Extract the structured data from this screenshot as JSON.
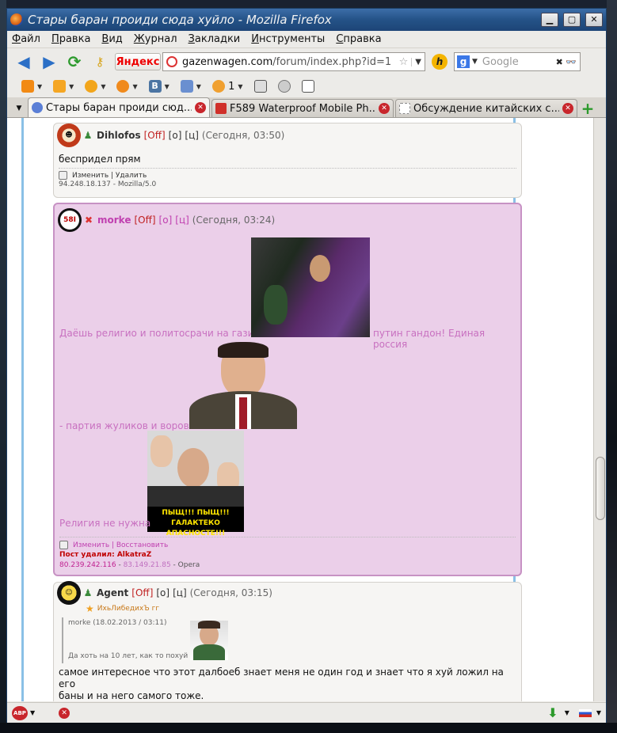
{
  "window": {
    "title": "Стары баран проиди сюда хуйло - Mozilla Firefox",
    "min_glyph": "▁",
    "max_glyph": "▢",
    "close_glyph": "✕"
  },
  "menu": [
    "Файл",
    "Правка",
    "Вид",
    "Журнал",
    "Закладки",
    "Инструменты",
    "Справка"
  ],
  "nav": {
    "yandex_label": "Яндекс",
    "url_domain": "gazenwagen.com",
    "url_path": "/forum/index.php?id=1",
    "search_placeholder": "Google",
    "h_label": "h"
  },
  "extbar": {
    "friends_count": "1"
  },
  "tabs": [
    {
      "label": "Стары баран проиди сюд...",
      "active": true,
      "fav_color": "#5b7fd6"
    },
    {
      "label": "F589 Waterproof Mobile Ph...",
      "active": false,
      "fav_color": "#d0302a"
    },
    {
      "label": "Обсуждение китайских с...",
      "active": false,
      "fav_color": "#cccccc"
    }
  ],
  "posts": [
    {
      "user": "Dihlofos",
      "off": "[Off]",
      "o": "[о]",
      "c": "[ц]",
      "date": "(Сегодня, 03:50)",
      "text": "беспридел прям",
      "actions": "Изменить | Удалить",
      "ip": "94.248.18.137 - Mozilla/5.0"
    },
    {
      "user": "morke",
      "off": "[Off]",
      "o": "[о]",
      "c": "[ц]",
      "date": "(Сегодня, 03:24)",
      "line1a": "Даёшь религио и политосрачи на газике",
      "line1b": "путин гандон! Единая россия",
      "line2": "- партия жуликов и воров",
      "line3": "Религия не нужна",
      "meme_caption_1": "ПЫЩ!!!  ПЫЩ!!!",
      "meme_caption_2": "ГАЛАКТЕКО АПАСНОСТЕ!!!",
      "avatar_text": "58I",
      "actions": "Изменить | Восстановить",
      "deleted_by": "Пост удалил: AlkatraZ",
      "ip1": "80.239.242.116",
      "ip2": "83.149.21.85",
      "browser": "Opera"
    },
    {
      "user": "Agent",
      "off": "[Off]",
      "o": "[о]",
      "c": "[ц]",
      "date": "(Сегодня, 03:15)",
      "subtitle": "ИхьЛибедихЪ гг",
      "quote_head": "morke (18.02.2013 / 03:11)",
      "quote_text": "Да хоть на 10 лет, как то похуй",
      "text_line1": "самое интересное что этот далбоеб знает меня не один год и знает что я хуй ложил на его",
      "text_line2": "баны и на него самого тоже."
    }
  ]
}
